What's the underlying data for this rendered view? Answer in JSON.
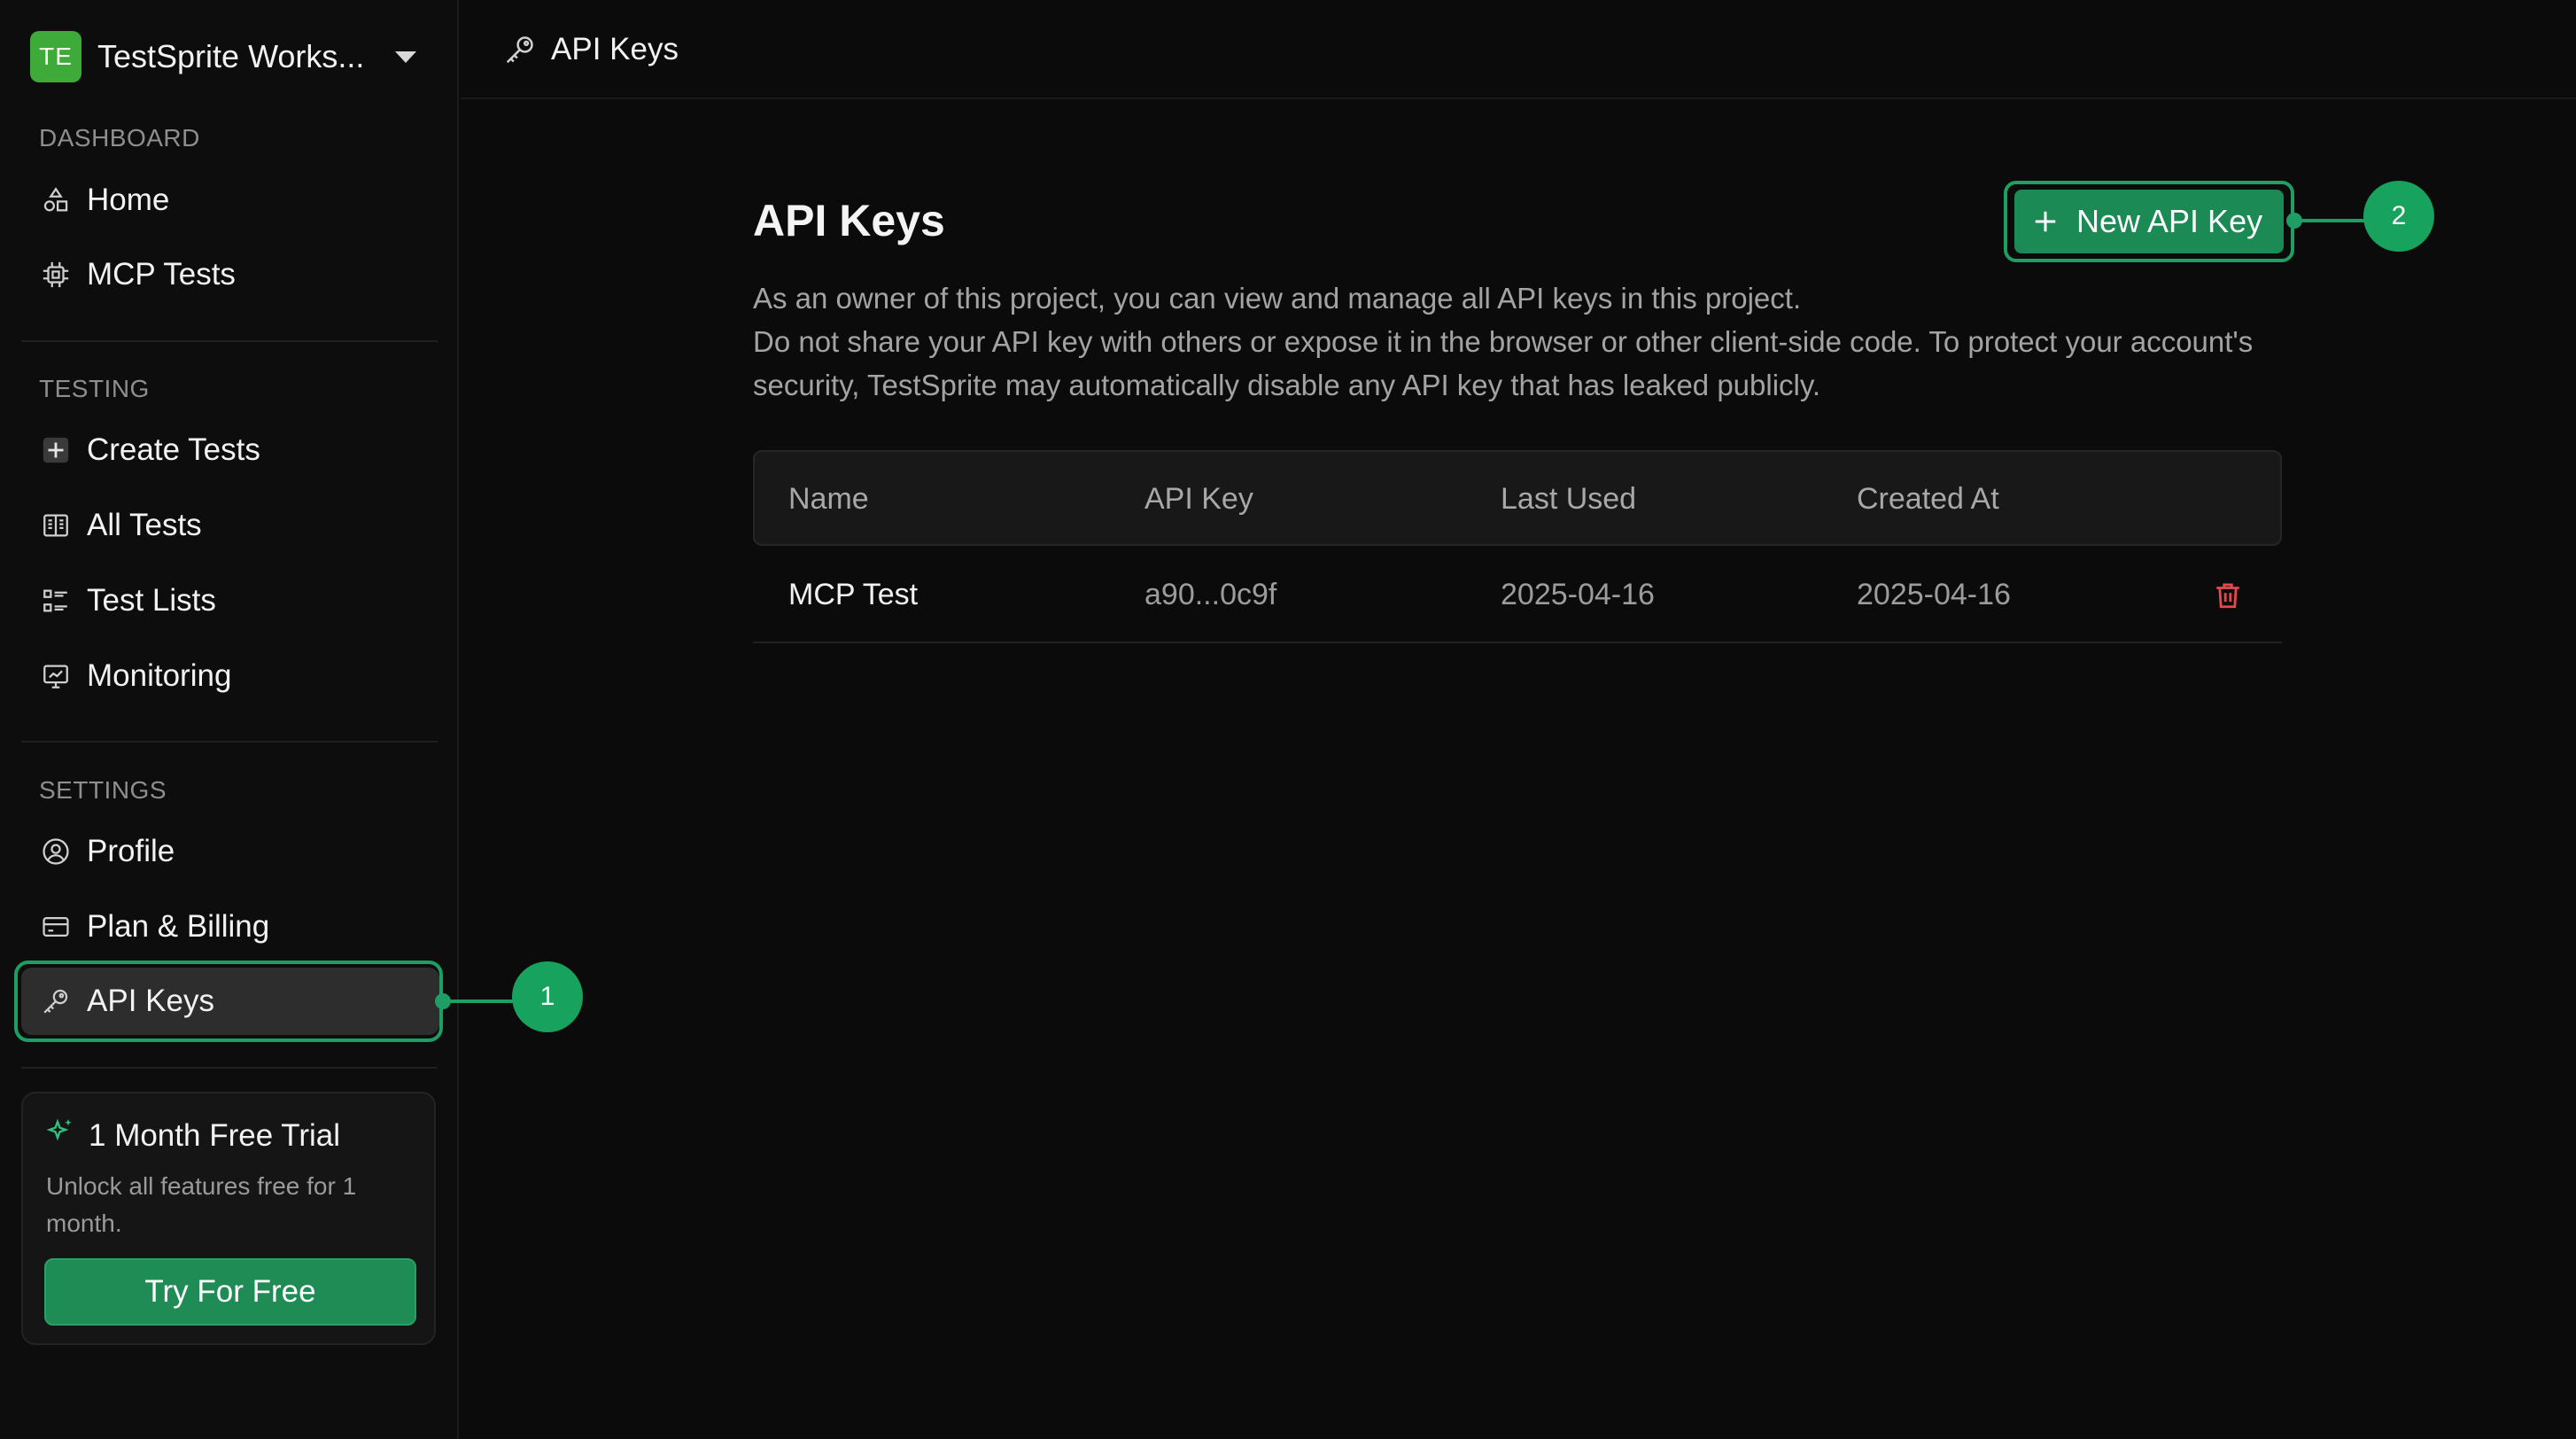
{
  "workspace": {
    "initials": "TE",
    "name": "TestSprite Works..."
  },
  "sections": {
    "dashboard": "DASHBOARD",
    "testing": "TESTING",
    "settings": "SETTINGS"
  },
  "nav": {
    "home": "Home",
    "mcp_tests": "MCP Tests",
    "create_tests": "Create Tests",
    "all_tests": "All Tests",
    "test_lists": "Test Lists",
    "monitoring": "Monitoring",
    "profile": "Profile",
    "plan_billing": "Plan & Billing",
    "api_keys": "API Keys"
  },
  "trial": {
    "title": "1 Month Free Trial",
    "description": "Unlock all features free for 1 month.",
    "button": "Try For Free"
  },
  "callouts": {
    "one": "1",
    "two": "2"
  },
  "breadcrumb": {
    "title": "API Keys"
  },
  "main": {
    "title": "API Keys",
    "desc_line1": "As an owner of this project, you can view and manage all API keys in this project.",
    "desc_line2": "Do not share your API key with others or expose it in the browser or other client-side code. To protect your account's security, TestSprite may automatically disable any API key that has leaked publicly.",
    "new_key_button": "New API Key"
  },
  "table": {
    "headers": [
      "Name",
      "API Key",
      "Last Used",
      "Created At"
    ],
    "rows": [
      {
        "name": "MCP Test",
        "key": "a90...0c9f",
        "last_used": "2025-04-16",
        "created_at": "2025-04-16"
      }
    ]
  },
  "colors": {
    "accent": "#1e9e64",
    "danger": "#e5484d",
    "avatar": "#3daa3a"
  }
}
